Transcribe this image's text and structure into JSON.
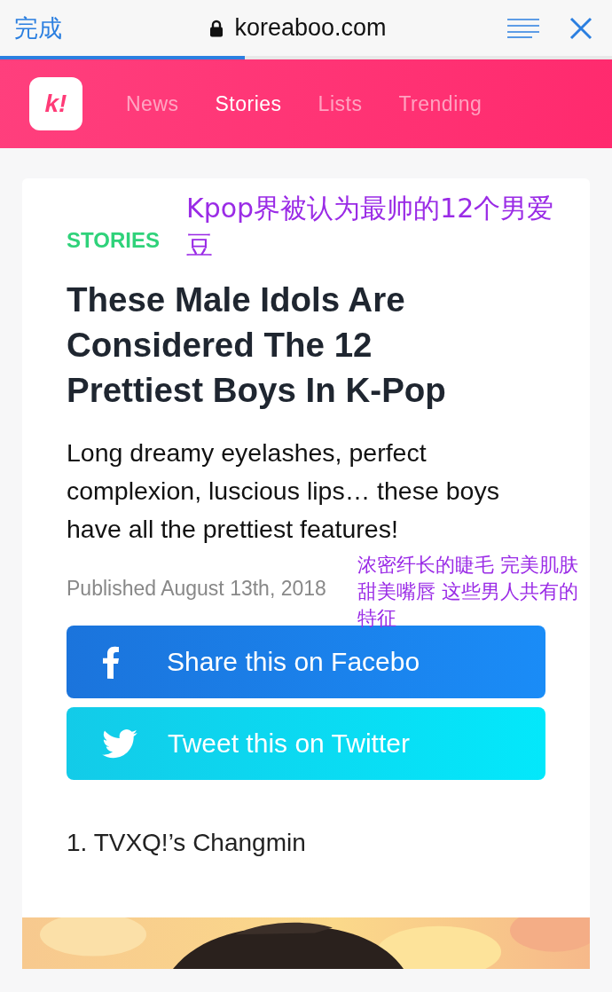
{
  "browser_bar": {
    "done": "完成",
    "url": "koreaboo.com",
    "load_progress": {
      "level": 0.4
    }
  },
  "nav": {
    "logo": "k!",
    "tabs": [
      {
        "label": "News",
        "selected": false
      },
      {
        "label": "Stories",
        "selected": true
      },
      {
        "label": "Lists",
        "selected": false
      },
      {
        "label": "Trending",
        "selected": false
      }
    ]
  },
  "article": {
    "category": "STORIES",
    "title": "These Male Idols Are Considered The 12 Prettiest Boys In K-Pop",
    "summary": "Long dreamy eyelashes, perfect complexion, luscious lips… these boys have all the prettiest features!",
    "published": "Published August 13th, 2018",
    "share_buttons": [
      {
        "kind": "facebook",
        "label": "Share this on Facebo"
      },
      {
        "kind": "twitter",
        "label": "Tweet this on Twitter"
      }
    ],
    "item_heading": "1. TVXQ!’s Changmin"
  },
  "annotations": [
    {
      "text": "Kpop界被认为最帅的12个男爱豆"
    },
    {
      "text": "浓密纤长的睫毛 完美肌肤甜美嘴唇 这些男人共有的特征"
    }
  ]
}
